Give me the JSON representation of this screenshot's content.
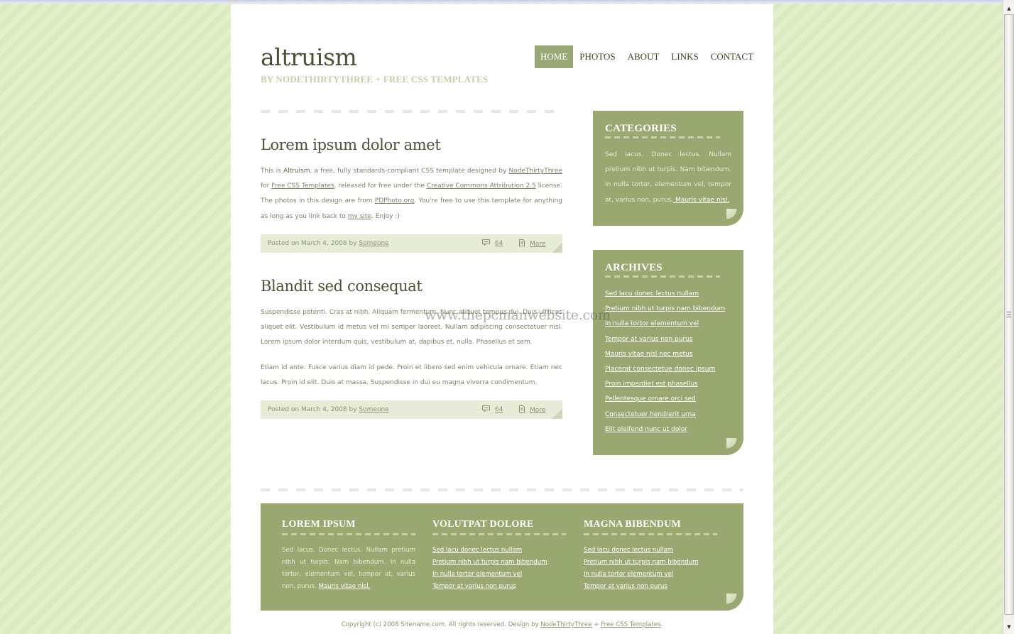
{
  "site": {
    "title": "altruism",
    "subtitle": "BY NODETHIRTYTHREE + FREE CSS TEMPLATES"
  },
  "nav": {
    "items": [
      {
        "label": "HOME",
        "active": true
      },
      {
        "label": "PHOTOS",
        "active": false
      },
      {
        "label": "ABOUT",
        "active": false
      },
      {
        "label": "LINKS",
        "active": false
      },
      {
        "label": "CONTACT",
        "active": false
      }
    ]
  },
  "posts": [
    {
      "title": "Lorem ipsum dolor amet",
      "body": {
        "t1": "This is ",
        "t2": "Altruism",
        "t3": ", a free, fully standards-compliant CSS template designed by ",
        "link1": "NodeThirtyThree",
        "t4": " for ",
        "link2": "Free CSS Templates",
        "t5": ", released for free under the ",
        "link3": "Creative Commons Attribution 2.5",
        "t6": " license. The photos in this design are from ",
        "link4": "PDPhoto.org",
        "t7": ". You're free to use this template for anything as long as you link back to ",
        "link5": "my site",
        "t8": ". Enjoy :)"
      },
      "meta": {
        "posted_prefix": "Posted on March 4, 2008 by ",
        "author": "Someone",
        "comments": "64",
        "more": "More"
      }
    },
    {
      "title": "Blandit sed consequat",
      "paragraphs": [
        "Suspendisse potenti. Cras at nibh. Aliquam fermentum. Nunc aliquet tempus dui. Duis ultrices aliquet elit. Vestibulum id metus vel mi semper laoreet. Nullam adipiscing consectetuer nisl. Lorem ipsum dolor interdum quis, vestibulum at, dapibus et, nulla. Phasellus et sem.",
        "Etiam id ante. Fusce varius diam id pede. Proin et libero sed enim vehicula ornare. Etiam nec lacus. Proin id elit. Duis at massa. Suspendisse in dui eu magna viverra condimentum."
      ],
      "meta": {
        "posted_prefix": "Posted on March 4, 2008 by ",
        "author": "Someone",
        "comments": "64",
        "more": "More"
      }
    }
  ],
  "sidebar": {
    "categories": {
      "title": "CATEGORIES",
      "text": "Sed lacus. Donec lectus. Nullam pretium nibh ut turpis. Nam bibendum. In nulla tortor, elementum vel, tempor at, varius non, purus.",
      "link": " Mauris vitae nisl."
    },
    "archives": {
      "title": "ARCHIVES",
      "links": [
        "Sed lacu donec lectus nullam",
        "Pretium nibh ut turpis nam bibendum",
        "In nulla tortor elementum vel",
        "Tempor at varius non purus",
        "Mauris vitae nisl nec metus",
        "Placerat consectetue donec ipsum",
        "Proin imperdiet est phasellus",
        "Pellentesque ornare orci sed",
        "Consectetuer hendrerit urna",
        "Elit eleifend nunc ut dolor"
      ]
    }
  },
  "footer": {
    "columns": [
      {
        "title": "LOREM IPSUM",
        "text": "Sed lacus. Donec lectus. Nullam pretium nibh ut turpis. Nam bibendum. In nulla tortor, elementum vel, tempor at, varius non, purus.",
        "link": "Mauris vitae nisl."
      },
      {
        "title": "VOLUTPAT DOLORE",
        "links": [
          "Sed lacu donec lectus nullam",
          "Pretium nibh ut turpis nam bibendum",
          "In nulla tortor elementum vel",
          "Tempor at varius non purus"
        ]
      },
      {
        "title": "MAGNA BIBENDUM",
        "links": [
          "Sed lacu donec lectus nullam",
          "Pretium nibh ut turpis nam bibendum",
          "In nulla tortor elementum vel",
          "Tempor at varius non purus"
        ]
      }
    ],
    "copyright": {
      "prefix": "Copyright (c) 2008 Sitename.com. All rights reserved. Design by ",
      "link1": "NodeThirtyThree",
      "separator": " + ",
      "link2": "Free CSS Templates",
      "suffix": "."
    }
  },
  "watermark": "www.thepcmanwebsite.com",
  "colors": {
    "accent": "#98a870",
    "nav_active": "#98a877",
    "heading": "#4b5235",
    "body_text": "#7c8266",
    "meta_bg": "#e6ecd7",
    "page_bg": "#e2efc8"
  },
  "scrollbar": {
    "up_glyph": "▲",
    "down_glyph": "▼"
  }
}
